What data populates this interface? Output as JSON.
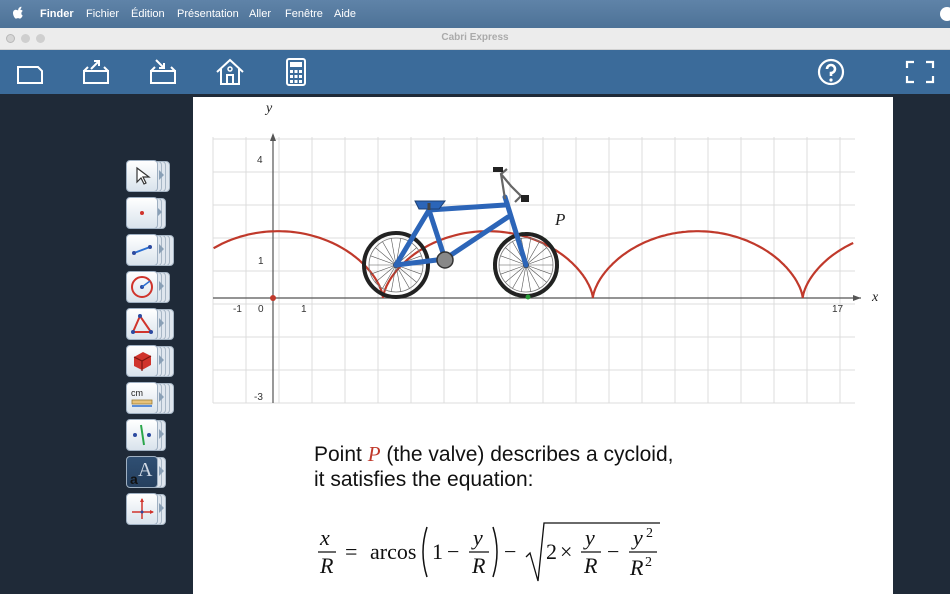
{
  "menubar": {
    "app": "Finder",
    "items": [
      "Fichier",
      "Édition",
      "Présentation",
      "Aller",
      "Fenêtre",
      "Aide"
    ]
  },
  "window": {
    "title": "Cabri Express"
  },
  "toolbar": {
    "icons": [
      "new-document-icon",
      "export-icon",
      "import-icon",
      "home-icon",
      "calculator-icon",
      "help-icon",
      "fullscreen-icon"
    ]
  },
  "tools": {
    "icons": [
      "pointer-icon",
      "point-icon",
      "segment-icon",
      "circle-icon",
      "triangle-icon",
      "solid-icon",
      "measure-icon",
      "perpendicular-icon",
      "text-icon",
      "axes-icon"
    ],
    "measure_label": "cm"
  },
  "graph": {
    "x_axis_label": "x",
    "y_axis_label": "y",
    "point_label": "P",
    "x_ticks": [
      "-1",
      "0",
      "1",
      "17"
    ],
    "y_ticks": [
      "4",
      "1",
      "-3"
    ],
    "curve_color": "#c0392b",
    "grid": true
  },
  "caption": {
    "line1_before": "Point ",
    "line1_point": "P",
    "line1_after": " (the valve) describes a cycloid,",
    "line2": "it satisfies the equation:"
  },
  "equation": {
    "lhs_num": "x",
    "lhs_den": "R",
    "eq": "=",
    "func": "arcos",
    "one": "1",
    "minus1": "−",
    "frac1_num": "y",
    "frac1_den": "R",
    "minus2": "−",
    "two": "2",
    "times": "×",
    "frac2_num": "y",
    "frac2_den": "R",
    "minus3": "−",
    "frac3_num": "y",
    "frac3_den": "R",
    "exp": "2"
  }
}
